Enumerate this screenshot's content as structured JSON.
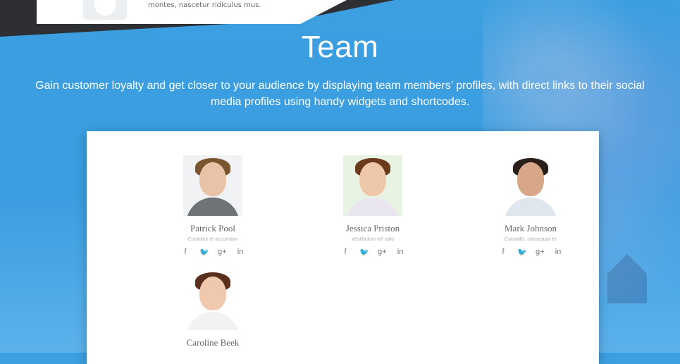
{
  "device": {
    "snippet_text": "montes, nascetur ridiculus mus."
  },
  "section": {
    "title": "Team",
    "subtitle": "Gain customer loyalty and get closer to your audience by displaying team members’ profiles, with direct links to their social media profiles using handy widgets and shortcodes."
  },
  "team": [
    {
      "name": "Patrick Pool",
      "role": "Curabitur et accumsan",
      "colors": {
        "bg": "#f1f2f4",
        "hair": "#7a5630",
        "shirt": "#6f7276",
        "skin": "#e9c3a7"
      }
    },
    {
      "name": "Jessica Priston",
      "role": "Vestibulum vel odio",
      "colors": {
        "bg": "#e9f3e4",
        "hair": "#6a3a1d",
        "shirt": "#e9e6f0",
        "skin": "#efc7aa"
      }
    },
    {
      "name": "Mark Johnson",
      "role": "Convallis, consequat ex",
      "colors": {
        "bg": "#ffffff",
        "hair": "#2a1f18",
        "shirt": "#dfe6ee",
        "skin": "#d8a789"
      }
    },
    {
      "name": "Caroline Beek",
      "role": "",
      "colors": {
        "bg": "#ffffff",
        "hair": "#5a2f1b",
        "shirt": "#f2f2f2",
        "skin": "#f0c8ad"
      }
    }
  ],
  "social_icons": {
    "facebook": "f",
    "twitter": "♥",
    "google_plus": "g+",
    "linkedin": "in"
  }
}
